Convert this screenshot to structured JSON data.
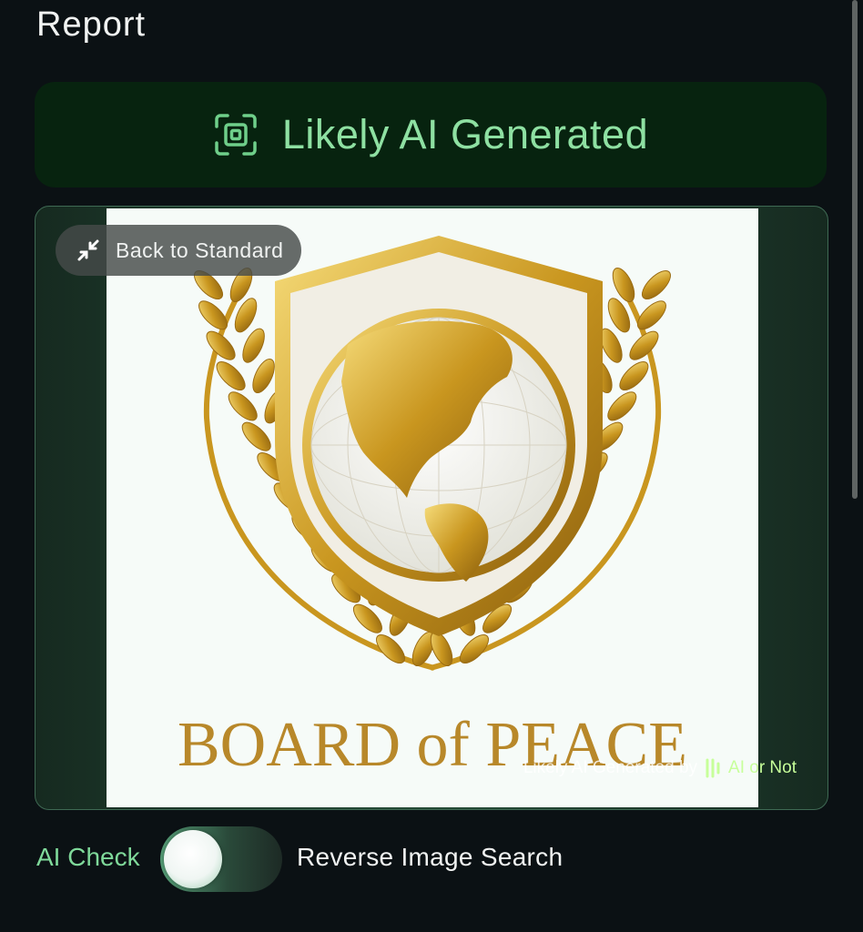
{
  "header": {
    "title": "Report"
  },
  "verdict": {
    "label": "Likely AI Generated",
    "icon": "scan-frame-icon",
    "color": "#8ee0a2"
  },
  "image_card": {
    "back_button_label": "Back to Standard",
    "back_button_icon": "collapse-arrows-icon",
    "image_text": "BOARD of PEACE",
    "watermark_text": "Likely AI Generated by",
    "watermark_brand": "AI or Not"
  },
  "toggle": {
    "left_label": "AI Check",
    "right_label": "Reverse Image Search",
    "selected": "AI Check"
  }
}
